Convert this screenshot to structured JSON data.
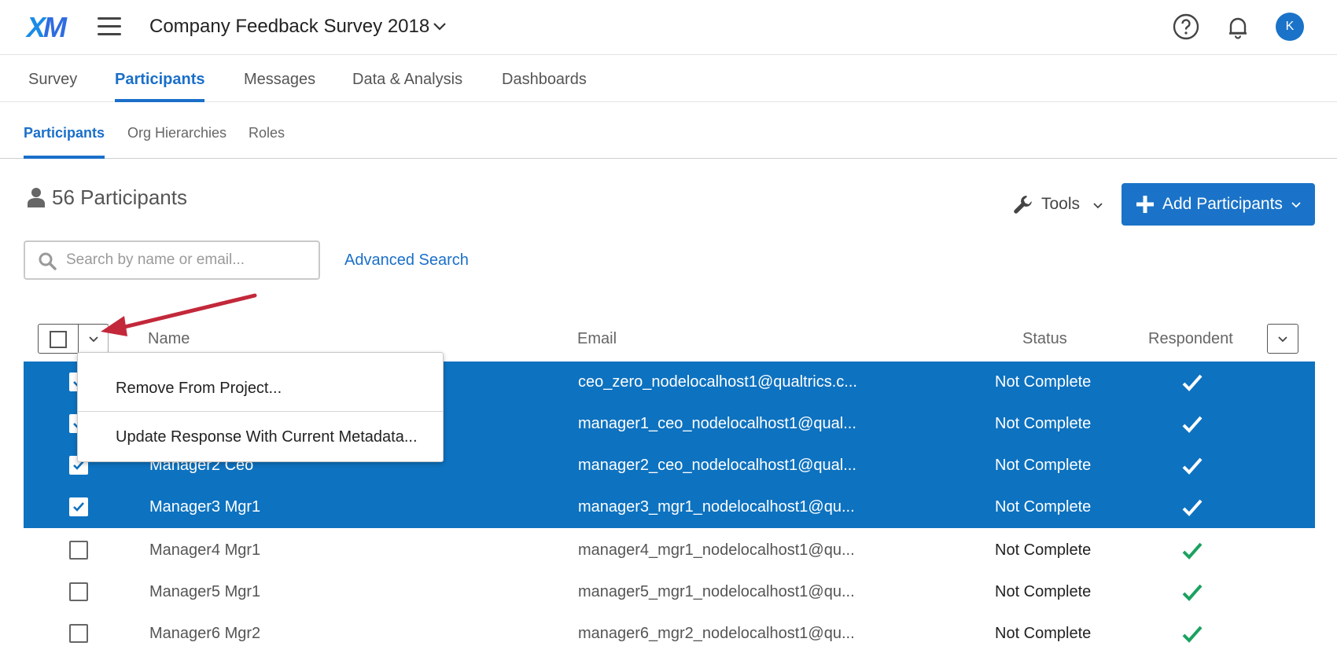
{
  "header": {
    "logo_x": "X",
    "logo_m": "M",
    "project_title": "Company Feedback Survey 2018",
    "avatar_initial": "K",
    "icons": [
      "menu-icon",
      "chevron-down-icon",
      "help-icon",
      "bell-icon"
    ]
  },
  "tabs": [
    {
      "label": "Survey",
      "active": false
    },
    {
      "label": "Participants",
      "active": true
    },
    {
      "label": "Messages",
      "active": false
    },
    {
      "label": "Data & Analysis",
      "active": false
    },
    {
      "label": "Dashboards",
      "active": false
    }
  ],
  "subtabs": [
    {
      "label": "Participants",
      "active": true
    },
    {
      "label": "Org Hierarchies",
      "active": false
    },
    {
      "label": "Roles",
      "active": false
    }
  ],
  "participants": {
    "count_label": "56 Participants"
  },
  "toolbar": {
    "tools_label": "Tools",
    "add_label": "Add Participants"
  },
  "search": {
    "placeholder": "Search by name or email...",
    "value": "",
    "advanced_label": "Advanced Search"
  },
  "table": {
    "columns": [
      "Name",
      "Email",
      "Status",
      "Respondent"
    ],
    "rows": [
      {
        "name": "",
        "email": "ceo_zero_nodelocalhost1@qualtrics.c...",
        "status": "Not Complete",
        "selected": true,
        "respondent": true
      },
      {
        "name": "",
        "email": "manager1_ceo_nodelocalhost1@qual...",
        "status": "Not Complete",
        "selected": true,
        "respondent": true
      },
      {
        "name": "Manager2 Ceo",
        "email": "manager2_ceo_nodelocalhost1@qual...",
        "status": "Not Complete",
        "selected": true,
        "respondent": true
      },
      {
        "name": "Manager3 Mgr1",
        "email": "manager3_mgr1_nodelocalhost1@qu...",
        "status": "Not Complete",
        "selected": true,
        "respondent": true
      },
      {
        "name": "Manager4 Mgr1",
        "email": "manager4_mgr1_nodelocalhost1@qu...",
        "status": "Not Complete",
        "selected": false,
        "respondent": true
      },
      {
        "name": "Manager5 Mgr1",
        "email": "manager5_mgr1_nodelocalhost1@qu...",
        "status": "Not Complete",
        "selected": false,
        "respondent": true
      },
      {
        "name": "Manager6 Mgr2",
        "email": "manager6_mgr2_nodelocalhost1@qu...",
        "status": "Not Complete",
        "selected": false,
        "respondent": true
      }
    ]
  },
  "bulk_menu": {
    "items": [
      "Remove From Project...",
      "Update Response With Current Metadata..."
    ]
  },
  "colors": {
    "accent": "#1a73c8",
    "selected_row": "#0d72c0",
    "check_green": "#1aa260",
    "annotation_arrow": "#c3283a"
  }
}
